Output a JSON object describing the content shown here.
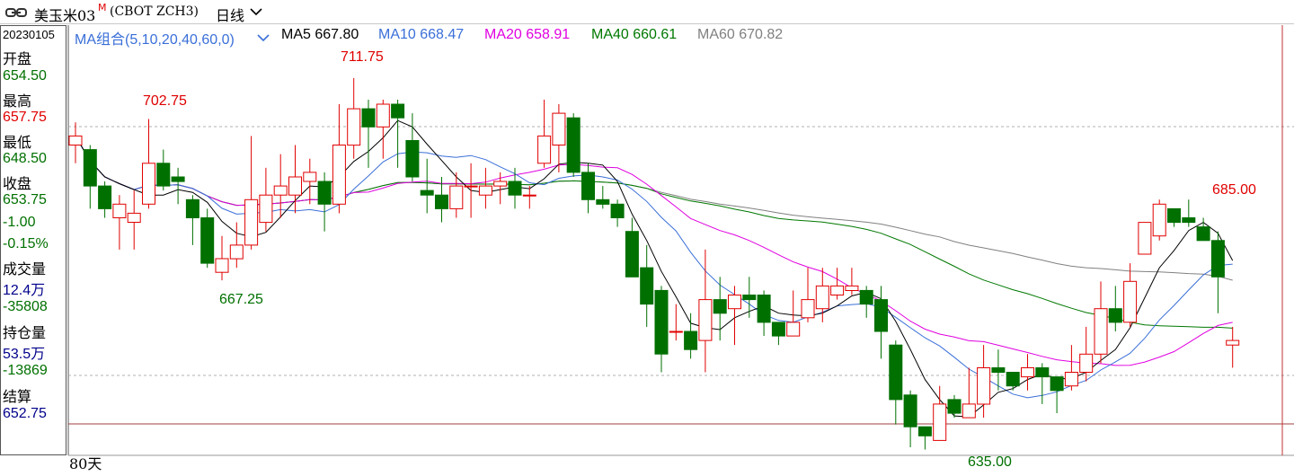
{
  "header": {
    "title": "美玉米03",
    "superscript": "M",
    "code": "(CBOT ZCH3)",
    "period": "日线"
  },
  "side_panel": {
    "date": "20230105",
    "open_label": "开盘",
    "open": "654.50",
    "high_label": "最高",
    "high": "657.75",
    "low_label": "最低",
    "low": "648.50",
    "close_label": "收盘",
    "close": "653.75",
    "change": "-1.00",
    "change_pct": "-0.15%",
    "volume_label": "成交量",
    "volume": "12.4万",
    "volume_change": "-35808",
    "oi_label": "持仓量",
    "oi": "53.5万",
    "oi_change": "-13869",
    "settle_label": "结算",
    "settle": "652.75"
  },
  "legend": {
    "group": "MA组合(5,10,20,40,60,0)",
    "ma5": "MA5 667.80",
    "ma10": "MA10 668.47",
    "ma20": "MA20 658.91",
    "ma40": "MA40 660.61",
    "ma60": "MA60 670.82"
  },
  "colors": {
    "up": "#e00000",
    "down": "#007000",
    "ma5": "#000000",
    "ma10": "#3a6fd8",
    "ma20": "#e000e0",
    "ma40": "#007800",
    "ma60": "#808080"
  },
  "footer": {
    "days": "80天"
  },
  "chart_data": {
    "type": "candlestick",
    "y_range": [
      630.5,
      714.5
    ],
    "annotations": {
      "max1": "702.75",
      "max2": "711.75",
      "min1": "667.25",
      "min2": "635.00",
      "max3": "685.00"
    },
    "candles": [
      [
        697,
        699,
        702,
        693
      ],
      [
        696,
        688,
        697,
        683
      ],
      [
        688,
        683,
        689,
        681
      ],
      [
        681,
        684,
        686,
        674
      ],
      [
        680,
        682,
        687,
        674
      ],
      [
        684,
        693,
        702.75,
        683
      ],
      [
        693,
        688,
        696,
        687
      ],
      [
        690,
        689,
        692,
        684
      ],
      [
        685,
        681,
        686,
        675
      ],
      [
        681,
        671,
        683,
        670
      ],
      [
        669,
        672,
        677,
        667.25
      ],
      [
        672,
        675,
        680,
        670
      ],
      [
        675,
        685,
        699,
        674
      ],
      [
        680,
        686,
        692,
        678
      ],
      [
        686,
        688,
        695,
        681
      ],
      [
        686,
        690,
        697,
        682
      ],
      [
        689,
        691,
        694,
        684
      ],
      [
        689,
        684,
        691,
        678
      ],
      [
        684,
        697,
        706,
        682
      ],
      [
        697,
        705,
        711.75,
        694
      ],
      [
        705,
        701,
        707,
        692
      ],
      [
        701,
        706,
        707,
        694
      ],
      [
        706,
        703,
        707,
        692
      ],
      [
        698,
        690,
        704,
        689
      ],
      [
        687,
        686,
        694,
        682
      ],
      [
        686,
        683,
        690,
        680
      ],
      [
        683,
        688,
        691,
        681
      ],
      [
        688,
        688,
        693,
        681
      ],
      [
        686,
        688,
        692,
        683
      ],
      [
        688,
        689,
        691,
        684
      ],
      [
        689,
        686,
        692,
        683
      ],
      [
        686,
        686,
        688,
        683
      ],
      [
        693,
        699,
        707,
        692
      ],
      [
        697,
        704,
        706,
        691
      ],
      [
        703,
        691,
        704,
        690
      ],
      [
        691,
        685,
        693,
        682
      ],
      [
        685,
        684,
        688,
        683
      ],
      [
        684,
        681,
        685,
        679
      ],
      [
        678,
        668,
        681,
        669
      ],
      [
        670,
        662,
        675,
        657
      ],
      [
        665,
        651,
        666,
        647
      ],
      [
        656,
        656,
        662,
        654
      ],
      [
        656,
        652,
        660,
        650
      ],
      [
        654,
        663,
        674,
        647
      ],
      [
        663,
        660,
        668,
        654
      ],
      [
        661,
        664,
        666,
        653
      ],
      [
        664,
        663,
        668,
        659
      ],
      [
        664,
        658,
        665,
        655
      ],
      [
        658,
        655,
        658,
        653
      ],
      [
        655,
        658,
        665,
        655
      ],
      [
        659,
        663,
        670,
        658
      ],
      [
        661,
        666,
        670,
        658
      ],
      [
        664,
        666,
        670,
        663
      ],
      [
        665,
        666,
        670,
        664
      ],
      [
        665,
        662,
        666,
        659
      ],
      [
        663,
        656,
        666,
        650
      ],
      [
        653,
        641,
        654,
        635.5
      ],
      [
        642,
        635,
        643,
        630.5
      ],
      [
        635,
        633,
        635,
        630
      ],
      [
        632,
        640,
        644,
        632
      ],
      [
        641,
        638,
        642,
        637
      ],
      [
        637,
        640,
        648,
        637
      ],
      [
        640,
        648,
        653,
        637
      ],
      [
        648,
        647,
        652,
        643
      ],
      [
        647,
        644,
        645,
        643
      ],
      [
        646,
        648,
        651,
        643
      ],
      [
        648,
        646,
        649,
        640
      ],
      [
        646,
        643,
        644,
        638
      ],
      [
        644,
        647,
        653,
        643
      ],
      [
        647,
        651,
        657,
        645
      ],
      [
        651,
        661,
        667,
        649
      ],
      [
        661,
        658,
        666,
        656
      ],
      [
        658,
        667,
        671,
        657
      ],
      [
        673,
        680,
        680,
        673
      ],
      [
        677,
        684,
        685,
        676
      ],
      [
        683,
        680,
        681,
        679
      ],
      [
        681,
        680,
        685,
        679
      ],
      [
        679,
        676,
        681,
        676
      ],
      [
        676,
        668,
        678,
        660
      ],
      [
        653,
        654,
        657,
        648
      ]
    ]
  }
}
